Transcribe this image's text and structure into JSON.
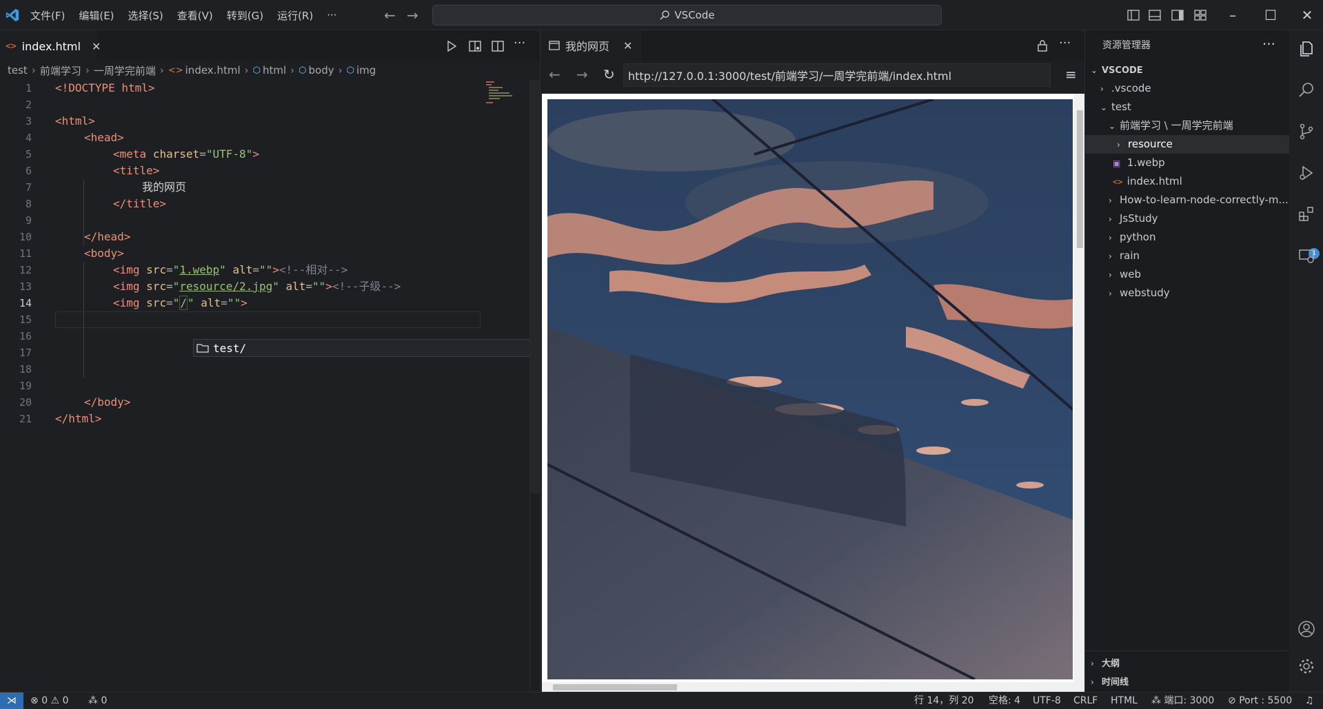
{
  "menu": [
    "文件(F)",
    "编辑(E)",
    "选择(S)",
    "查看(V)",
    "转到(G)",
    "运行(R)",
    "···"
  ],
  "command_center": "VSCode",
  "editor": {
    "tab_label": "index.html",
    "breadcrumbs": [
      "test",
      "前端学习",
      "一周学完前端",
      "index.html",
      "html",
      "body",
      "img"
    ],
    "line_numbers": [
      "1",
      "2",
      "3",
      "4",
      "5",
      "6",
      "7",
      "8",
      "9",
      "10",
      "11",
      "12",
      "13",
      "14",
      "15",
      "16",
      "17",
      "18",
      "19",
      "20",
      "21"
    ],
    "current_line": "14",
    "code": {
      "l1_doctype": "<!DOCTYPE html>",
      "html_open": "<html>",
      "head_open": "<head>",
      "meta": "<meta",
      "charset_attr": "charset",
      "charset_val": "\"UTF-8\"",
      "title_open": "<title>",
      "title_text": "我的网页",
      "title_close": "</title>",
      "head_close": "</head>",
      "body_open": "<body>",
      "img": "<img",
      "src_attr": "src",
      "alt_attr": "alt",
      "src1": "1.webp",
      "src2": "resource/2.jpg",
      "src3": "/",
      "empty_val": "\"\"",
      "comment1": "<!--相对-->",
      "comment2": "<!--子级-->",
      "body_close": "</body>",
      "html_close": "</html>"
    },
    "suggestion": "test/"
  },
  "preview": {
    "tab_label": "我的网页",
    "url": "http://127.0.0.1:3000/test/前端学习/一周学完前端/index.html"
  },
  "explorer": {
    "title": "资源管理器",
    "root": "VSCODE",
    "items": [
      {
        "label": ".vscode",
        "kind": "folder",
        "open": false
      },
      {
        "label": "test",
        "kind": "folder",
        "open": true
      },
      {
        "label": "前端学习 \\ 一周学完前端",
        "kind": "folder",
        "open": true
      },
      {
        "label": "resource",
        "kind": "folder",
        "open": false
      },
      {
        "label": "1.webp",
        "kind": "image"
      },
      {
        "label": "index.html",
        "kind": "html"
      },
      {
        "label": "How-to-learn-node-correctly-m...",
        "kind": "folder",
        "open": false
      },
      {
        "label": "JsStudy",
        "kind": "folder",
        "open": false
      },
      {
        "label": "python",
        "kind": "folder",
        "open": false
      },
      {
        "label": "rain",
        "kind": "folder",
        "open": false
      },
      {
        "label": "web",
        "kind": "folder",
        "open": false
      },
      {
        "label": "webstudy",
        "kind": "folder",
        "open": false
      }
    ],
    "outline": "大纲",
    "timeline": "时间线"
  },
  "activity_badge": "1",
  "status": {
    "errors": "0",
    "warnings": "0",
    "ports_count": "0",
    "position": "行 14，列 20",
    "spaces": "空格: 4",
    "encoding": "UTF-8",
    "eol": "CRLF",
    "language": "HTML",
    "port_label": "端口: 3000",
    "live_port": "Port : 5500"
  },
  "colors": {
    "accent": "#2f6db3",
    "tag": "#ec9177",
    "string": "#98c379",
    "attribute": "#e2c08d",
    "comment": "#7f848e"
  }
}
